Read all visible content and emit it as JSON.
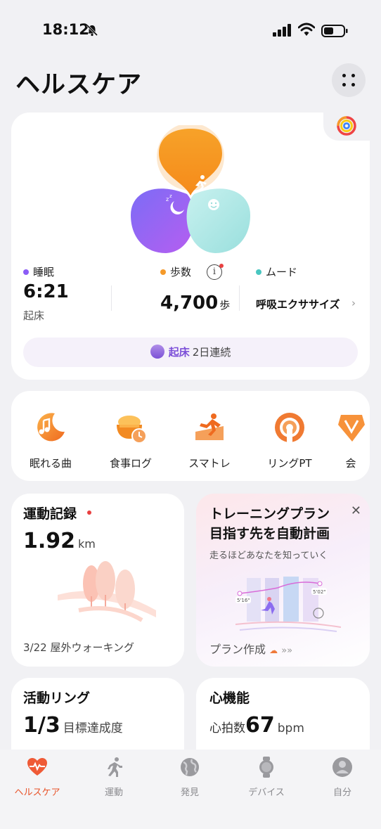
{
  "status_bar": {
    "time": "18:12"
  },
  "header": {
    "title": "ヘルスケア"
  },
  "summary": {
    "sleep": {
      "label": "睡眠",
      "value": "6:21",
      "sub": "起床",
      "color": "#8b5cf6"
    },
    "steps": {
      "label": "歩数",
      "value": "4,700",
      "unit": "歩",
      "color": "#f59a2a"
    },
    "mood": {
      "label": "ムード",
      "action": "呼吸エクササイズ",
      "color": "#49c6c0"
    },
    "streak": {
      "keyword": "起床",
      "text": "2日連続"
    }
  },
  "shortcuts": [
    {
      "label": "眠れる曲",
      "icon": "sleep-music-icon"
    },
    {
      "label": "食事ログ",
      "icon": "meal-log-icon"
    },
    {
      "label": "スマトレ",
      "icon": "smart-training-icon"
    },
    {
      "label": "リングPT",
      "icon": "ring-pt-icon"
    },
    {
      "label": "会",
      "icon": "member-icon"
    }
  ],
  "exercise": {
    "title": "運動記録",
    "value": "1.92",
    "unit": "km",
    "footer": "3/22 屋外ウォーキング"
  },
  "plan": {
    "title_line1": "トレーニングプラン",
    "title_line2": "目指す先を自動計画",
    "subtitle": "走るほどあなたを知っていく",
    "footer": "プラン作成",
    "chart_tags": [
      "5'16\"",
      "5'02\""
    ]
  },
  "activity_ring": {
    "title": "活動リング",
    "value": "1/3",
    "label": "目標達成度"
  },
  "heart": {
    "title": "心機能",
    "label": "心拍数",
    "value": "67",
    "unit": "bpm"
  },
  "tabs": [
    {
      "label": "ヘルスケア",
      "icon": "health-heart-icon",
      "active": true
    },
    {
      "label": "運動",
      "icon": "running-icon",
      "active": false
    },
    {
      "label": "発見",
      "icon": "discover-globe-icon",
      "active": false
    },
    {
      "label": "デバイス",
      "icon": "watch-icon",
      "active": false
    },
    {
      "label": "自分",
      "icon": "profile-icon",
      "active": false
    }
  ],
  "colors": {
    "accent": "#e8542a",
    "sleep": "#8b5cf6",
    "steps": "#f59a2a",
    "mood": "#49c6c0"
  }
}
